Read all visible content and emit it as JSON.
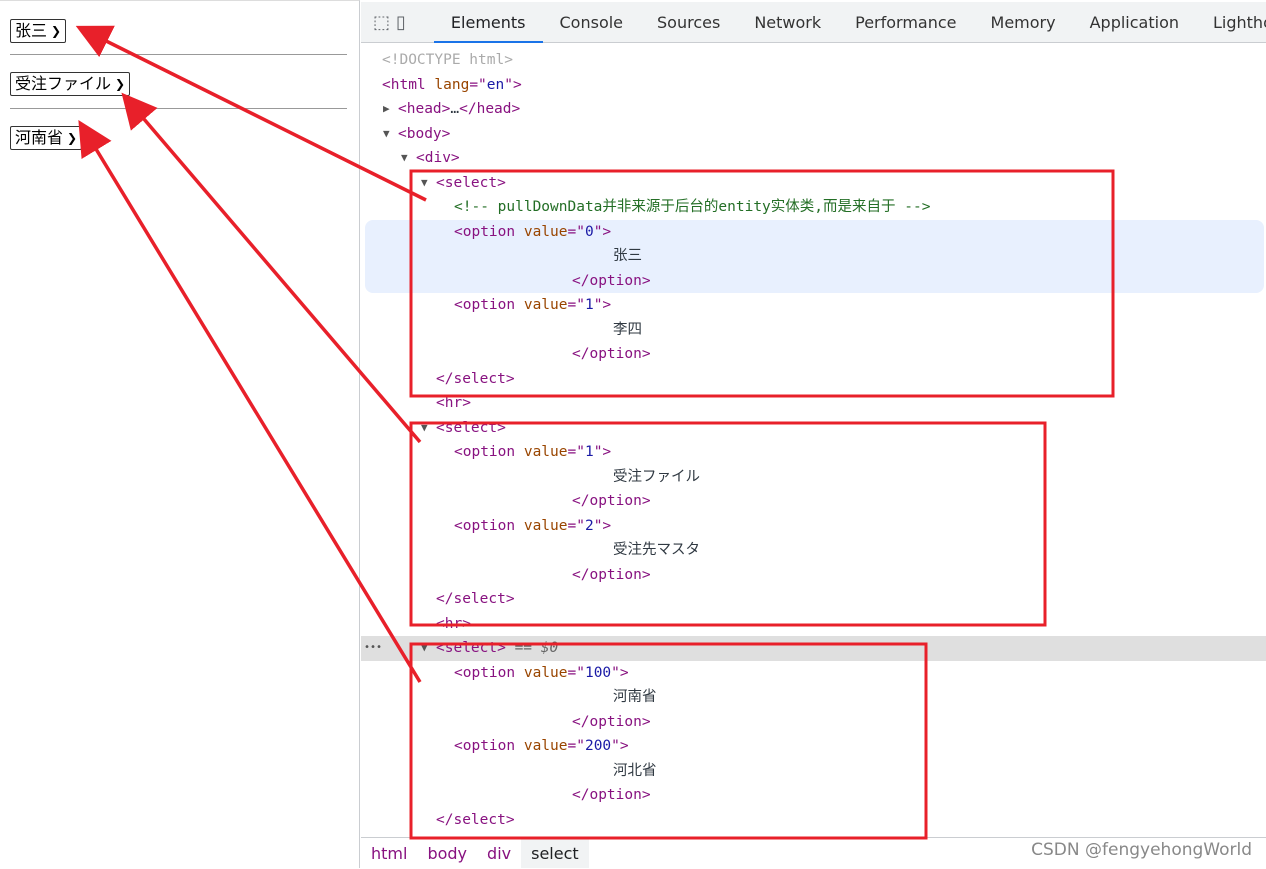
{
  "page": {
    "selects": [
      {
        "value": "张三"
      },
      {
        "value": "受注ファイル"
      },
      {
        "value": "河南省"
      }
    ]
  },
  "devtools": {
    "icons": [
      "inspect-element-icon",
      "device-toolbar-icon"
    ],
    "tabs": [
      "Elements",
      "Console",
      "Sources",
      "Network",
      "Performance",
      "Memory",
      "Application",
      "Lighthouse"
    ],
    "active_tab": "Elements",
    "tree": [
      {
        "d": 0,
        "tk": [
          [
            "dim",
            "<!DOCTYPE html>"
          ]
        ]
      },
      {
        "d": 0,
        "tk": [
          [
            "tag",
            "<html "
          ],
          [
            "attr",
            "lang"
          ],
          [
            "tag",
            "=\""
          ],
          [
            "val",
            "en"
          ],
          [
            "tag",
            "\">"
          ]
        ]
      },
      {
        "d": 1,
        "tri": "▶",
        "tk": [
          [
            "tag",
            "<head>"
          ],
          [
            "txt",
            "…"
          ],
          [
            "tag",
            "</head>"
          ]
        ]
      },
      {
        "d": 1,
        "tri": "▼",
        "tk": [
          [
            "tag",
            "<body>"
          ]
        ]
      },
      {
        "d": 2,
        "tri": "▼",
        "tk": [
          [
            "tag",
            "<div>"
          ]
        ]
      },
      {
        "d": 3,
        "tri": "▼",
        "tk": [
          [
            "tag",
            "<select>"
          ]
        ]
      },
      {
        "d": 4,
        "tk": [
          [
            "cm",
            "<!-- pullDownData并非来源于后台的entity实体类,而是来自于 -->"
          ]
        ]
      },
      {
        "d": 4,
        "hl": true,
        "tk": [
          [
            "tag",
            "<option "
          ],
          [
            "attr",
            "value"
          ],
          [
            "tag",
            "=\""
          ],
          [
            "val",
            "0"
          ],
          [
            "tag",
            "\">"
          ]
        ]
      },
      {
        "d": "text",
        "hl": true,
        "tk": [
          [
            "txt",
            "张三"
          ]
        ]
      },
      {
        "d": "close",
        "hl": true,
        "tk": [
          [
            "tag",
            "</option>"
          ]
        ]
      },
      {
        "d": 4,
        "tk": [
          [
            "tag",
            "<option "
          ],
          [
            "attr",
            "value"
          ],
          [
            "tag",
            "=\""
          ],
          [
            "val",
            "1"
          ],
          [
            "tag",
            "\">"
          ]
        ]
      },
      {
        "d": "text",
        "tk": [
          [
            "txt",
            "李四"
          ]
        ]
      },
      {
        "d": "close",
        "tk": [
          [
            "tag",
            "</option>"
          ]
        ]
      },
      {
        "d": 3,
        "tk": [
          [
            "tag",
            "</select>"
          ]
        ]
      },
      {
        "d": 3,
        "tk": [
          [
            "tag",
            "<hr>"
          ]
        ]
      },
      {
        "d": 3,
        "tri": "▼",
        "tk": [
          [
            "tag",
            "<select>"
          ]
        ]
      },
      {
        "d": 4,
        "tk": [
          [
            "tag",
            "<option "
          ],
          [
            "attr",
            "value"
          ],
          [
            "tag",
            "=\""
          ],
          [
            "val",
            "1"
          ],
          [
            "tag",
            "\">"
          ]
        ]
      },
      {
        "d": "text",
        "tk": [
          [
            "txt",
            "受注ファイル"
          ]
        ]
      },
      {
        "d": "close",
        "tk": [
          [
            "tag",
            "</option>"
          ]
        ]
      },
      {
        "d": 4,
        "tk": [
          [
            "tag",
            "<option "
          ],
          [
            "attr",
            "value"
          ],
          [
            "tag",
            "=\""
          ],
          [
            "val",
            "2"
          ],
          [
            "tag",
            "\">"
          ]
        ]
      },
      {
        "d": "text",
        "tk": [
          [
            "txt",
            "受注先マスタ"
          ]
        ]
      },
      {
        "d": "close",
        "tk": [
          [
            "tag",
            "</option>"
          ]
        ]
      },
      {
        "d": 3,
        "tk": [
          [
            "tag",
            "</select>"
          ]
        ]
      },
      {
        "d": 3,
        "tk": [
          [
            "tag",
            "<hr>"
          ]
        ]
      },
      {
        "d": 3,
        "tri": "▼",
        "selected": true,
        "tk": [
          [
            "tag",
            "<select>"
          ],
          [
            "eq",
            " == $0"
          ]
        ]
      },
      {
        "d": 4,
        "tk": [
          [
            "tag",
            "<option "
          ],
          [
            "attr",
            "value"
          ],
          [
            "tag",
            "=\""
          ],
          [
            "val",
            "100"
          ],
          [
            "tag",
            "\">"
          ]
        ]
      },
      {
        "d": "text",
        "tk": [
          [
            "txt",
            "河南省"
          ]
        ]
      },
      {
        "d": "close",
        "tk": [
          [
            "tag",
            "</option>"
          ]
        ]
      },
      {
        "d": 4,
        "tk": [
          [
            "tag",
            "<option "
          ],
          [
            "attr",
            "value"
          ],
          [
            "tag",
            "=\""
          ],
          [
            "val",
            "200"
          ],
          [
            "tag",
            "\">"
          ]
        ]
      },
      {
        "d": "text",
        "tk": [
          [
            "txt",
            "河北省"
          ]
        ]
      },
      {
        "d": "close",
        "tk": [
          [
            "tag",
            "</option>"
          ]
        ]
      },
      {
        "d": 3,
        "tk": [
          [
            "tag",
            "</select>"
          ]
        ]
      }
    ],
    "breadcrumbs": [
      "html",
      "body",
      "div",
      "select"
    ],
    "active_crumb": "select"
  },
  "watermark": "CSDN @fengyehongWorld",
  "colors": {
    "annotation": "#e8202a",
    "accent": "#1a73e8"
  }
}
